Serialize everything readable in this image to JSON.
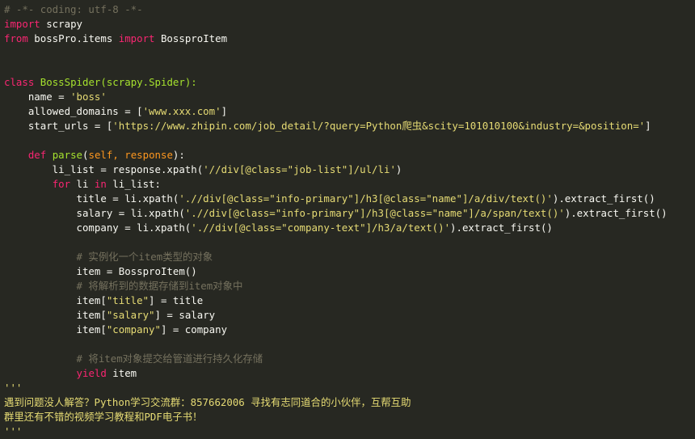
{
  "editor": {
    "lines": [
      [
        {
          "t": "# -*- coding: utf-8 -*-",
          "c": "cm"
        }
      ],
      [
        {
          "t": "import",
          "c": "kw"
        },
        {
          "t": " scrapy",
          "c": ""
        }
      ],
      [
        {
          "t": "from",
          "c": "kw"
        },
        {
          "t": " bossPro.items ",
          "c": ""
        },
        {
          "t": "import",
          "c": "kw"
        },
        {
          "t": " BossproItem",
          "c": ""
        }
      ],
      [],
      [],
      [
        {
          "t": "class",
          "c": "kw"
        },
        {
          "t": " ",
          "c": ""
        },
        {
          "t": "BossSpider",
          "c": "fn"
        },
        {
          "t": "(scrapy.Spider):",
          "c": "fn"
        }
      ],
      [
        {
          "t": "    name = ",
          "c": ""
        },
        {
          "t": "'boss'",
          "c": "st"
        }
      ],
      [
        {
          "t": "    allowed_domains = [",
          "c": ""
        },
        {
          "t": "'www.xxx.com'",
          "c": "st"
        },
        {
          "t": "]",
          "c": ""
        }
      ],
      [
        {
          "t": "    start_urls = [",
          "c": ""
        },
        {
          "t": "'https://www.zhipin.com/job_detail/?query=Python爬虫&scity=101010100&industry=&position='",
          "c": "st"
        },
        {
          "t": "]",
          "c": ""
        }
      ],
      [],
      [
        {
          "t": "    ",
          "c": ""
        },
        {
          "t": "def",
          "c": "kw"
        },
        {
          "t": " ",
          "c": ""
        },
        {
          "t": "parse",
          "c": "fn"
        },
        {
          "t": "(",
          "c": ""
        },
        {
          "t": "self, response",
          "c": "pr"
        },
        {
          "t": "):",
          "c": ""
        }
      ],
      [
        {
          "t": "        li_list = response.xpath(",
          "c": ""
        },
        {
          "t": "'//div[@class=\"job-list\"]/ul/li'",
          "c": "st"
        },
        {
          "t": ")",
          "c": ""
        }
      ],
      [
        {
          "t": "        ",
          "c": ""
        },
        {
          "t": "for",
          "c": "kw"
        },
        {
          "t": " li ",
          "c": ""
        },
        {
          "t": "in",
          "c": "kw"
        },
        {
          "t": " li_list:",
          "c": ""
        }
      ],
      [
        {
          "t": "            title = li.xpath(",
          "c": ""
        },
        {
          "t": "'.//div[@class=\"info-primary\"]/h3[@class=\"name\"]/a/div/text()'",
          "c": "st"
        },
        {
          "t": ").extract_first()",
          "c": ""
        }
      ],
      [
        {
          "t": "            salary = li.xpath(",
          "c": ""
        },
        {
          "t": "'.//div[@class=\"info-primary\"]/h3[@class=\"name\"]/a/span/text()'",
          "c": "st"
        },
        {
          "t": ").extract_first()",
          "c": ""
        }
      ],
      [
        {
          "t": "            company = li.xpath(",
          "c": ""
        },
        {
          "t": "'.//div[@class=\"company-text\"]/h3/a/text()'",
          "c": "st"
        },
        {
          "t": ").extract_first()",
          "c": ""
        }
      ],
      [],
      [
        {
          "t": "            # 实例化一个item类型的对象",
          "c": "cm"
        }
      ],
      [
        {
          "t": "            item = BossproItem()",
          "c": ""
        }
      ],
      [
        {
          "t": "            # 将解析到的数据存储到item对象中",
          "c": "cm"
        }
      ],
      [
        {
          "t": "            item[",
          "c": ""
        },
        {
          "t": "\"title\"",
          "c": "st"
        },
        {
          "t": "] = title",
          "c": ""
        }
      ],
      [
        {
          "t": "            item[",
          "c": ""
        },
        {
          "t": "\"salary\"",
          "c": "st"
        },
        {
          "t": "] = salary",
          "c": ""
        }
      ],
      [
        {
          "t": "            item[",
          "c": ""
        },
        {
          "t": "\"company\"",
          "c": "st"
        },
        {
          "t": "] = company",
          "c": ""
        }
      ],
      [],
      [
        {
          "t": "            # 将item对象提交给管道进行持久化存储",
          "c": "cm"
        }
      ],
      [
        {
          "t": "            ",
          "c": ""
        },
        {
          "t": "yield",
          "c": "kw"
        },
        {
          "t": " item",
          "c": ""
        }
      ],
      [
        {
          "t": "'''",
          "c": "st"
        }
      ],
      [
        {
          "t": "遇到问题没人解答？Python学习交流群：857662006 寻找有志同道合的小伙伴，互帮互助",
          "c": "st"
        }
      ],
      [
        {
          "t": "群里还有不错的视频学习教程和PDF电子书！",
          "c": "st"
        }
      ],
      [
        {
          "t": "'''",
          "c": "st"
        }
      ]
    ]
  }
}
